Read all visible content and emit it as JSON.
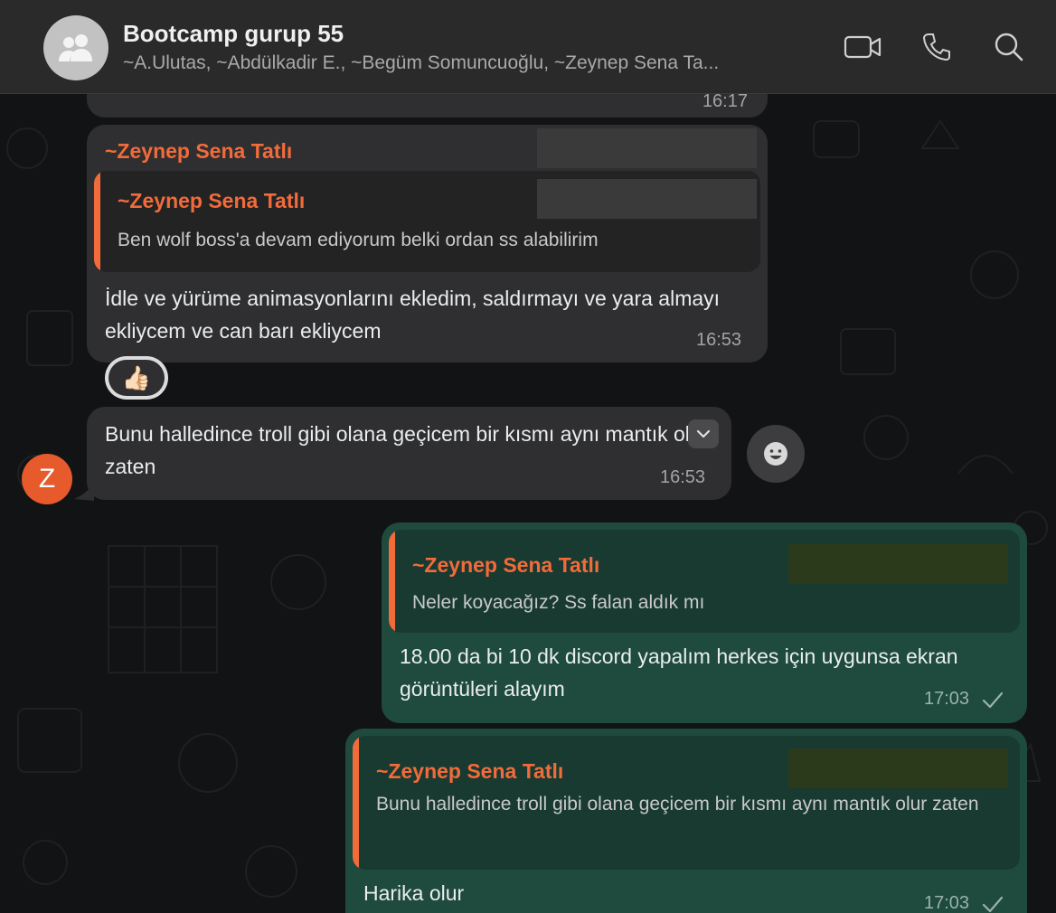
{
  "header": {
    "title": "Bootcamp gurup 55",
    "subtitle": "~A.Ulutas, ~Abdülkadir E., ~Begüm Somuncuoğlu, ~Zeynep Sena Ta..."
  },
  "icons": {
    "group": "group-icon",
    "video": "video-call-icon",
    "phone": "phone-icon",
    "search": "search-icon",
    "emoji": "emoji-icon",
    "chevron": "chevron-down-icon",
    "check": "check-icon"
  },
  "colors": {
    "sender": "#f26b3a",
    "incoming": "#2f2f31",
    "outgoing": "#1f4a3e",
    "avatar": "#e65a2c"
  },
  "messages": {
    "m0": {
      "time": "16:17"
    },
    "m1": {
      "sender": "~Zeynep Sena Tatlı",
      "quote_sender": "~Zeynep Sena Tatlı",
      "quote_text": "Ben wolf boss'a devam ediyorum belki ordan ss alabilirim",
      "text": "İdle ve yürüme animasyonlarını ekledim, saldırmayı ve yara almayı ekliycem ve can barı ekliycem",
      "time": "16:53",
      "reaction": "👍🏻"
    },
    "m2": {
      "avatar_letter": "Z",
      "text": "Bunu halledince troll gibi olana geçicem bir kısmı aynı mantık olur zaten",
      "time": "16:53"
    },
    "m3": {
      "quote_sender": "~Zeynep Sena Tatlı",
      "quote_text": "Neler koyacağız? Ss falan aldık mı",
      "text": "18.00 da bi 10 dk discord yapalım  herkes için uygunsa ekran görüntüleri alayım",
      "time": "17:03"
    },
    "m4": {
      "quote_sender": "~Zeynep Sena Tatlı",
      "quote_text": "Bunu halledince troll gibi olana geçicem bir kısmı aynı mantık olur zaten",
      "text": "Harika olur",
      "time": "17:03"
    }
  }
}
